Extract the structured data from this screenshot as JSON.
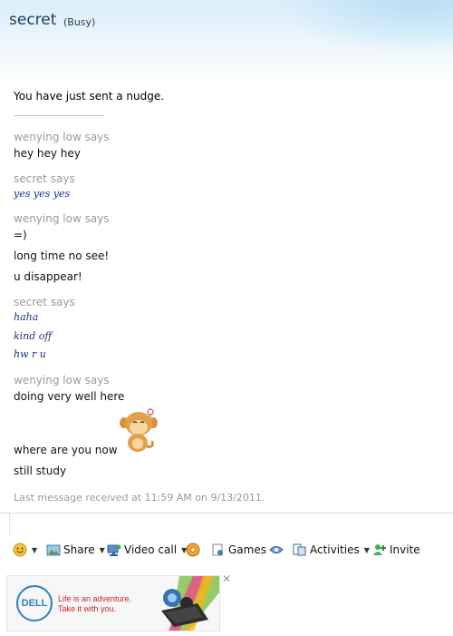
{
  "header": {
    "contact_name": "secret",
    "contact_status": "(Busy)"
  },
  "conversation": {
    "nudge_notice": "You have just sent a nudge.",
    "blocks": [
      {
        "sender": "wenying low says",
        "messages": [
          "hey hey hey"
        ]
      },
      {
        "sender": "secret says",
        "messages": [
          "yes yes yes"
        ]
      },
      {
        "sender": "wenying low says",
        "messages": [
          "=)",
          "long time no see!",
          "u disappear!"
        ]
      },
      {
        "sender": "secret says",
        "messages": [
          "haha",
          "kind off",
          "hw r u"
        ]
      },
      {
        "sender": "wenying low says",
        "messages": [
          "doing very well here",
          "where are you now",
          "still study"
        ]
      }
    ],
    "last_message": "Last message received at 11:59 AM on 9/13/2011."
  },
  "toolbar": {
    "share_label": "Share",
    "video_call_label": "Video call",
    "games_label": "Games",
    "activities_label": "Activities",
    "invite_label": "Invite"
  },
  "ad": {
    "brand": "DELL",
    "tagline_line1": "Life is an adventure.",
    "tagline_line2": "Take it with you."
  },
  "colors": {
    "says": "#9a9a9a",
    "their_message": "#1f2d8c",
    "header_bg": "#dbeefa"
  },
  "icons": [
    "emoticon-icon",
    "share-icon",
    "video-call-icon",
    "winks-icon",
    "games-icon",
    "nudge-icon",
    "activities-icon",
    "invite-icon",
    "close-icon",
    "monkey-emoticon"
  ]
}
